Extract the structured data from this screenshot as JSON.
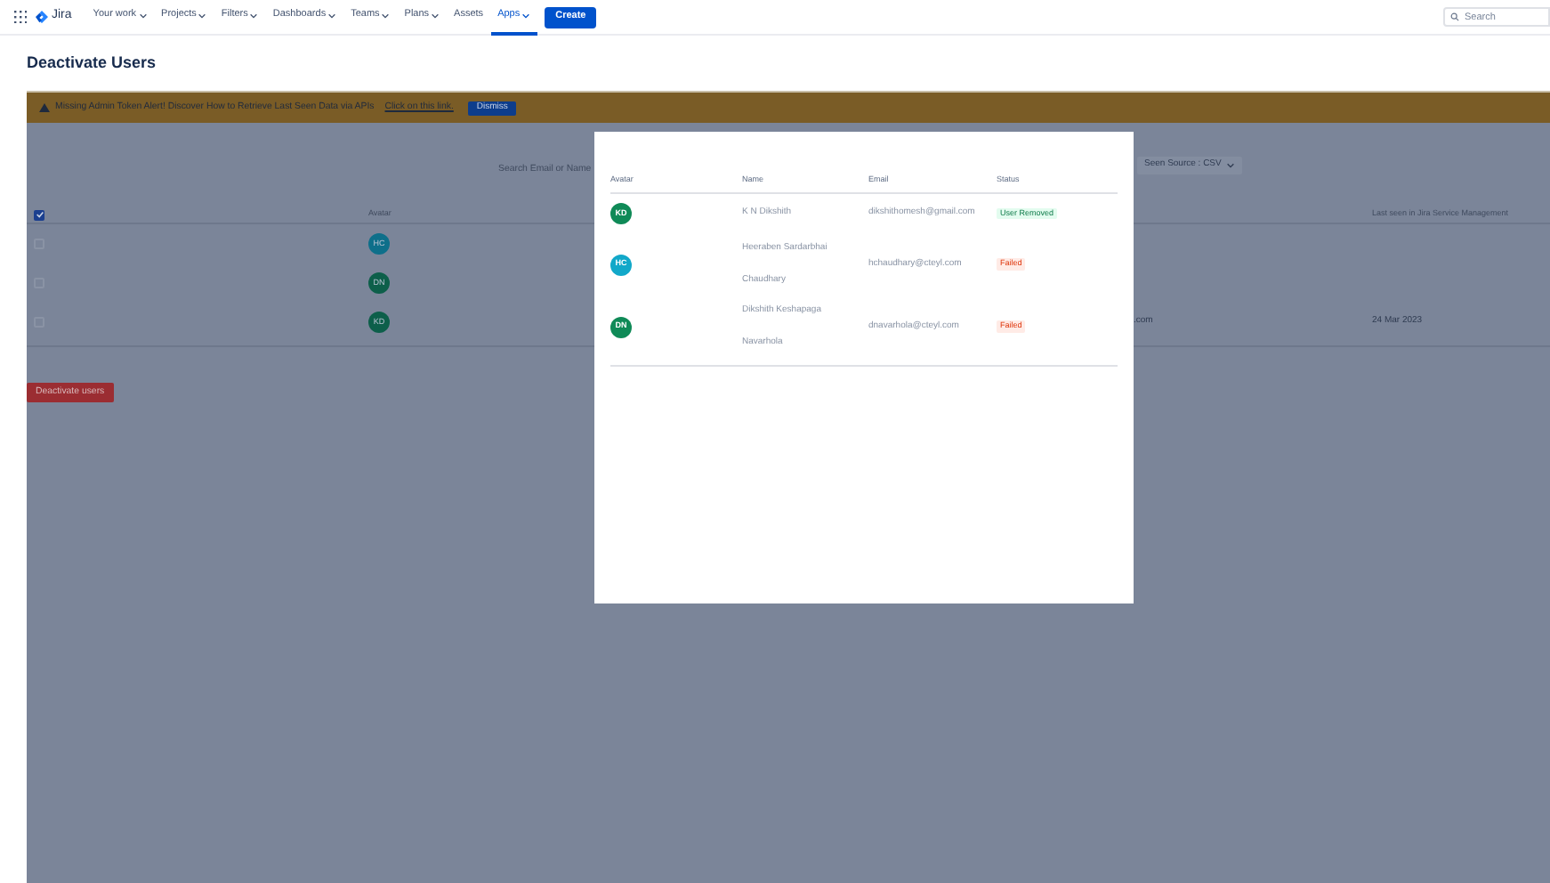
{
  "nav": {
    "brand": "Jira",
    "items": [
      {
        "label": "Your work",
        "dropdown": true,
        "selected": false
      },
      {
        "label": "Projects",
        "dropdown": true,
        "selected": false
      },
      {
        "label": "Filters",
        "dropdown": true,
        "selected": false
      },
      {
        "label": "Dashboards",
        "dropdown": true,
        "selected": false
      },
      {
        "label": "Teams",
        "dropdown": true,
        "selected": false
      },
      {
        "label": "Plans",
        "dropdown": true,
        "selected": false
      },
      {
        "label": "Assets",
        "dropdown": false,
        "selected": false
      },
      {
        "label": "Apps",
        "dropdown": true,
        "selected": true
      }
    ],
    "create": "Create",
    "search": {
      "placeholder": "Search"
    }
  },
  "page_title": "Deactivate Users",
  "banner": {
    "text": "Missing Admin Token Alert! Discover How to Retrieve Last Seen Data via APIs",
    "link": "Click on this link.",
    "button": "Dismiss"
  },
  "filters": {
    "search_placeholder": "Search Email or Name",
    "source": "Seen Source : CSV"
  },
  "table": {
    "select_all": true,
    "columns": [
      "Avatar",
      "Last seen in Jira Service Management"
    ],
    "rows": [
      {
        "checked": false,
        "initials": "HC",
        "color": "#0e6f8a",
        "email_fragment": "",
        "last_seen": ""
      },
      {
        "checked": false,
        "initials": "DN",
        "color": "#0d5f4a",
        "email_fragment": "",
        "last_seen": ""
      },
      {
        "checked": false,
        "initials": "KD",
        "color": "#0d5f4a",
        "email_fragment": ".com",
        "last_seen": "24 Mar 2023"
      }
    ]
  },
  "deactivate_button": "Deactivate users",
  "modal": {
    "columns": [
      "Avatar",
      "Name",
      "Email",
      "Status"
    ],
    "rows": [
      {
        "initials": "KD",
        "color": "#0f8a57",
        "name": [
          "K N Dikshith"
        ],
        "email": "dikshithomesh@gmail.com",
        "status": "User Removed",
        "success": true
      },
      {
        "initials": "HC",
        "color": "#12a8c9",
        "name": [
          "Heeraben Sardarbhai",
          "Chaudhary"
        ],
        "email": "hchaudhary@cteyl.com",
        "status": "Failed",
        "success": false
      },
      {
        "initials": "DN",
        "color": "#0f8a57",
        "name": [
          "Dikshith Keshapaga",
          "Navarhola"
        ],
        "email": "dnavarhola@cteyl.com",
        "status": "Failed",
        "success": false
      }
    ]
  }
}
